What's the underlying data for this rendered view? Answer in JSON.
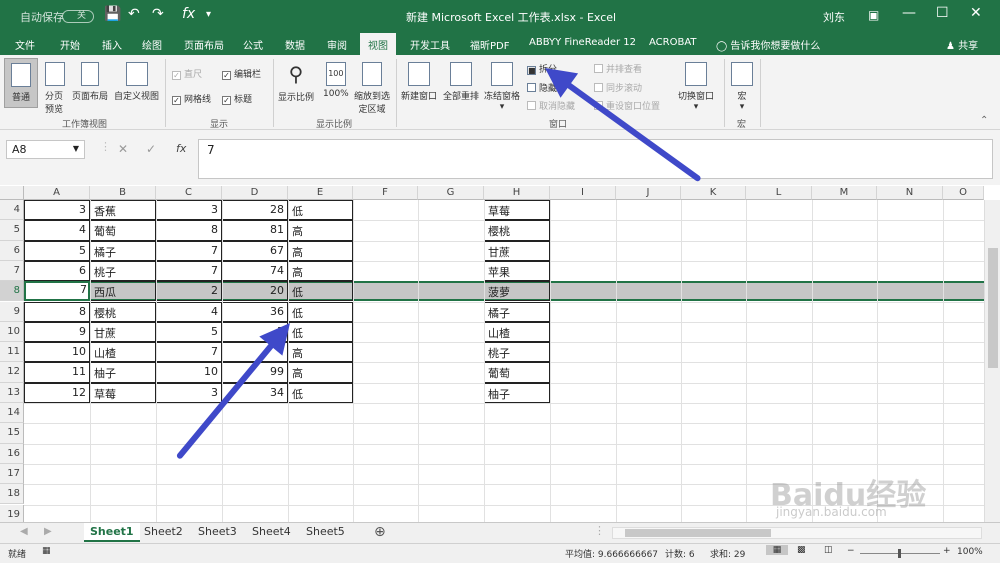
{
  "window": {
    "title": "新建 Microsoft Excel 工作表.xlsx - Excel",
    "autosave": "自动保存",
    "autosave_state": "关",
    "user": "刘东"
  },
  "tabs": [
    "文件",
    "开始",
    "插入",
    "绘图",
    "页面布局",
    "公式",
    "数据",
    "审阅",
    "视图",
    "开发工具",
    "福昕PDF",
    "ABBYY FineReader 12",
    "ACROBAT"
  ],
  "tell_me": "告诉我你想要做什么",
  "share": "共享",
  "ribbon": {
    "workbook_views": {
      "label": "工作簿视图",
      "normal": "普通",
      "page_break": "分页预览",
      "page_layout": "页面布局",
      "custom": "自定义视图"
    },
    "show": {
      "label": "显示",
      "ruler": "直尺",
      "formula_bar": "编辑栏",
      "gridlines": "网格线",
      "headings": "标题"
    },
    "zoom": {
      "label": "显示比例",
      "zoom": "显示比例",
      "hundred": "100%",
      "zoom_sel": "缩放到选定区域"
    },
    "window": {
      "label": "窗口",
      "new_window": "新建窗口",
      "arrange_all": "全部重排",
      "freeze": "冻结窗格",
      "split": "拆分",
      "hide": "隐藏",
      "unhide": "取消隐藏",
      "side_by_side": "并排查看",
      "sync_scroll": "同步滚动",
      "reset_pos": "重设窗口位置",
      "switch": "切换窗口"
    },
    "macros": {
      "label": "宏",
      "macro": "宏"
    }
  },
  "formula": {
    "cell_ref": "A8",
    "value": "7",
    "fx": "fx"
  },
  "columns": [
    "A",
    "B",
    "C",
    "D",
    "E",
    "F",
    "G",
    "H",
    "I",
    "J",
    "K",
    "L",
    "M",
    "N",
    "O"
  ],
  "rows": [
    {
      "n": "4",
      "a": "3",
      "b": "香蕉",
      "c": "3",
      "d": "28",
      "e": "低",
      "h": "草莓"
    },
    {
      "n": "5",
      "a": "4",
      "b": "葡萄",
      "c": "8",
      "d": "81",
      "e": "高",
      "h": "樱桃"
    },
    {
      "n": "6",
      "a": "5",
      "b": "橘子",
      "c": "7",
      "d": "67",
      "e": "高",
      "h": "甘蔗"
    },
    {
      "n": "7",
      "a": "6",
      "b": "桃子",
      "c": "7",
      "d": "74",
      "e": "高",
      "h": "苹果"
    },
    {
      "n": "8",
      "a": "7",
      "b": "西瓜",
      "c": "2",
      "d": "20",
      "e": "低",
      "h": "菠萝"
    },
    {
      "n": "9",
      "a": "8",
      "b": "樱桃",
      "c": "4",
      "d": "36",
      "e": "低",
      "h": "橘子"
    },
    {
      "n": "10",
      "a": "9",
      "b": "甘蔗",
      "c": "5",
      "d": "5",
      "e": "低",
      "h": "山楂"
    },
    {
      "n": "11",
      "a": "10",
      "b": "山楂",
      "c": "7",
      "d": "",
      "e": "高",
      "h": "桃子"
    },
    {
      "n": "12",
      "a": "11",
      "b": "柚子",
      "c": "10",
      "d": "99",
      "e": "高",
      "h": "葡萄"
    },
    {
      "n": "13",
      "a": "12",
      "b": "草莓",
      "c": "3",
      "d": "34",
      "e": "低",
      "h": "柚子"
    },
    {
      "n": "14"
    },
    {
      "n": "15"
    },
    {
      "n": "16"
    },
    {
      "n": "17"
    },
    {
      "n": "18"
    },
    {
      "n": "19"
    }
  ],
  "sheets": [
    "Sheet1",
    "Sheet2",
    "Sheet3",
    "Sheet4",
    "Sheet5"
  ],
  "status": {
    "mode": "就绪",
    "average": "平均值: 9.666666667",
    "count": "计数: 6",
    "sum": "求和: 29",
    "zoom": "100%"
  },
  "watermark": "Baidu经验",
  "watermark_sub": "jingyan.baidu.com",
  "colors": {
    "accent": "#217346",
    "arrow": "#3f49c9",
    "selected_row": "#c6c6c6"
  }
}
